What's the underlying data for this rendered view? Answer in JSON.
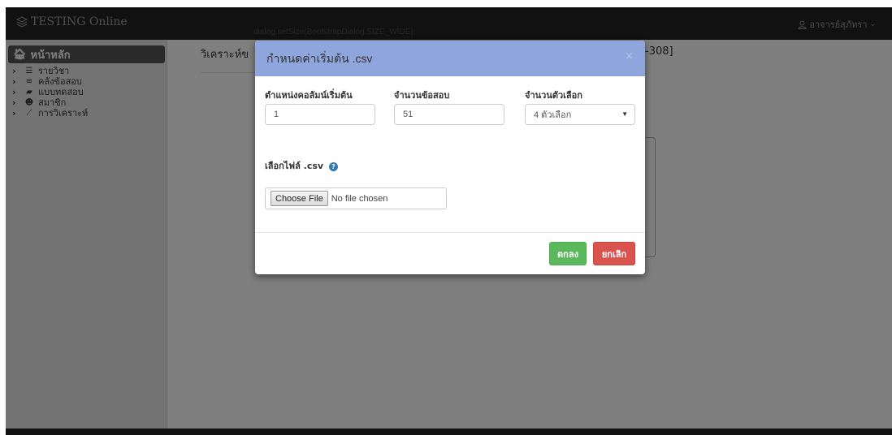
{
  "navbar": {
    "brand": "TESTING Online",
    "debug_text": "dialog.setSize(BootstrapDialog.SIZE_WIDE);",
    "user_label": "อาจารย์สุภัทรา"
  },
  "sidebar": {
    "home_label": "หน้าหลัก",
    "items": [
      {
        "label": "รายวิชา",
        "icon": "list-icon"
      },
      {
        "label": "คลังข้อสอบ",
        "icon": "database-icon"
      },
      {
        "label": "แบบทดสอบ",
        "icon": "book-icon"
      },
      {
        "label": "สมาชิก",
        "icon": "users-icon"
      },
      {
        "label": "การวิเคราะห์",
        "icon": "chart-icon"
      }
    ]
  },
  "content": {
    "title": "วิเคราะห์ข",
    "title_tail": "-308]"
  },
  "modal": {
    "title": "กำหนดค่าเริ่มต้น .csv",
    "close": "×",
    "start_column_label": "ตำแหน่งคอลัมน์เริ่มต้น",
    "start_column_value": "1",
    "question_count_label": "จำนวนข้อสอบ",
    "question_count_value": "51",
    "choice_count_label": "จำนวนตัวเลือก",
    "choice_count_value": "4 ตัวเลือก",
    "file_label": "เลือกไฟล์ .csv",
    "file_button": "Choose File",
    "file_status": "No file chosen",
    "ok_label": "ตกลง",
    "cancel_label": "ยกเลิก"
  },
  "colors": {
    "modal_header": "#8ea6db",
    "ok_button": "#5cb85c",
    "cancel_button": "#d9534f",
    "navbar": "#222222"
  }
}
